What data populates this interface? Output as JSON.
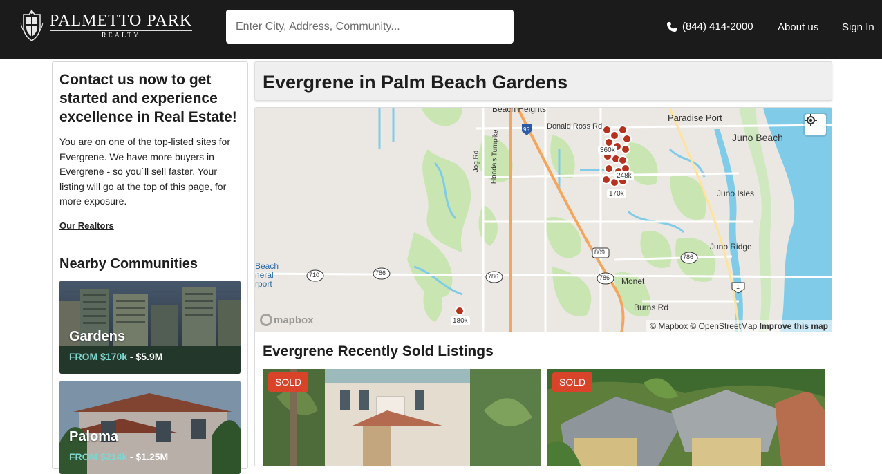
{
  "header": {
    "logo_name": "PALMETTO PARK",
    "logo_sub": "REALTY",
    "search_placeholder": "Enter City, Address, Community...",
    "phone": "(844) 414-2000",
    "about": "About us",
    "signin": "Sign In"
  },
  "sidebar": {
    "heading": "Contact us now to get started and experience excellence in Real Estate!",
    "body": "You are on one of the top-listed sites for Evergrene. We have more buyers in Evergrene - so you`ll sell faster. Your listing will go at the top of this page, for more exposure.",
    "link": "Our Realtors",
    "nearby_heading": "Nearby Communities",
    "communities": [
      {
        "name": "Gardens",
        "from_label": "FROM $170k",
        "to_label": " - $5.9M"
      },
      {
        "name": "Paloma",
        "from_label": "FROM $214k",
        "to_label": " - $1.25M"
      }
    ]
  },
  "main": {
    "title": "Evergrene in Palm Beach Gardens",
    "section_title": "Evergrene Recently Sold Listings",
    "listings": [
      {
        "badge": "SOLD"
      },
      {
        "badge": "SOLD"
      }
    ]
  },
  "map": {
    "places": {
      "beach_heights": "Beach Heights",
      "paradise_port": "Paradise Port",
      "juno_beach": "Juno Beach",
      "juno_isles": "Juno Isles",
      "juno_ridge": "Juno Ridge",
      "monet": "Monet",
      "burns_rd": "Burns Rd",
      "donald_ross": "Donald Ross Rd",
      "jog_rd": "Jog Rd",
      "turnpike": "Florida's Turnpike",
      "beach_1": "Beach",
      "beach_2": "neral",
      "beach_3": "rport"
    },
    "shields": [
      "95",
      "809",
      "786",
      "786",
      "786",
      "786",
      "710",
      "1"
    ],
    "price_labels": [
      "360k",
      "248k",
      "170k",
      "180k"
    ],
    "mapbox_text": "mapbox",
    "attribution": "© Mapbox © OpenStreetMap",
    "improve": "Improve this map"
  },
  "colors": {
    "header_bg": "#1b1b1b",
    "sold_badge": "#d8432a",
    "price_from": "#7fd6cf",
    "marker": "#b5321f",
    "water": "#7fcbe8",
    "park": "#c9e6b2"
  }
}
